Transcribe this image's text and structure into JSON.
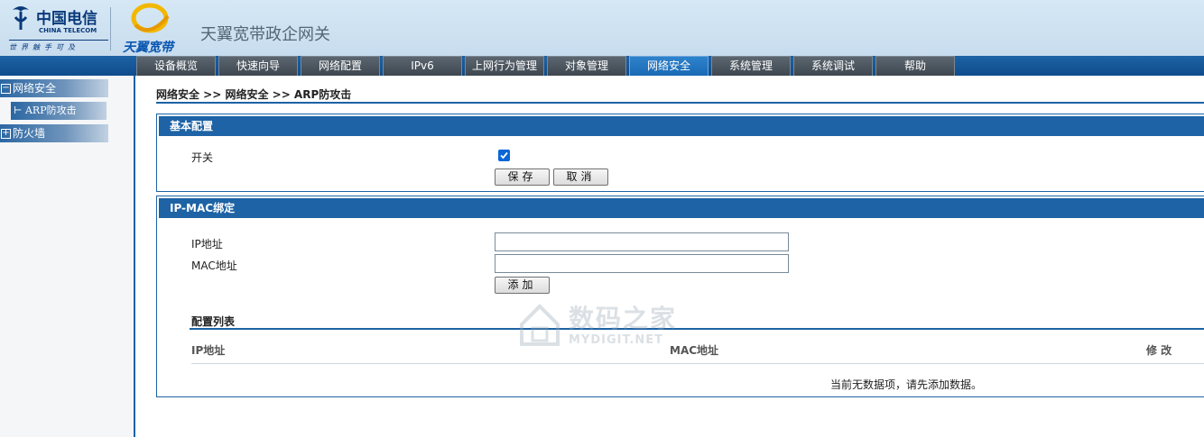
{
  "header": {
    "telecom_logo_cn": "中国电信",
    "telecom_logo_en": "CHINA TELECOM",
    "telecom_slogan": "世界触手可及",
    "tianyi_logo": "天翼宽带",
    "app_title": "天翼宽带政企网关"
  },
  "nav": {
    "tabs": [
      "设备概览",
      "快速向导",
      "网络配置",
      "IPv6",
      "上网行为管理",
      "对象管理",
      "网络安全",
      "系统管理",
      "系统调试",
      "帮助"
    ],
    "active_index": 6
  },
  "sidebar": {
    "group1_label": "网络安全",
    "group1_sub_label": "ARP防攻击",
    "group2_label": "防火墙"
  },
  "breadcrumb": "网络安全 >> 网络安全 >> ARP防攻击",
  "basic": {
    "title": "基本配置",
    "switch_label": "开关",
    "switch_checked": true,
    "save_label": "保存",
    "cancel_label": "取消"
  },
  "ipmac": {
    "title": "IP-MAC绑定",
    "ip_label": "IP地址",
    "ip_value": "",
    "mac_label": "MAC地址",
    "mac_value": "",
    "add_label": "添加"
  },
  "list": {
    "title": "配置列表",
    "col_ip": "IP地址",
    "col_mac": "MAC地址",
    "col_edit": "修 改",
    "empty_text": "当前无数据项，请先添加数据。"
  },
  "watermark": {
    "cn": "数码之家",
    "en": "MYDIGIT.NET"
  },
  "colors": {
    "accent": "#1d63a5",
    "tab_inactive": "#4a535c",
    "tab_active": "#2a7cc6",
    "checkbox": "#0b66d6"
  }
}
